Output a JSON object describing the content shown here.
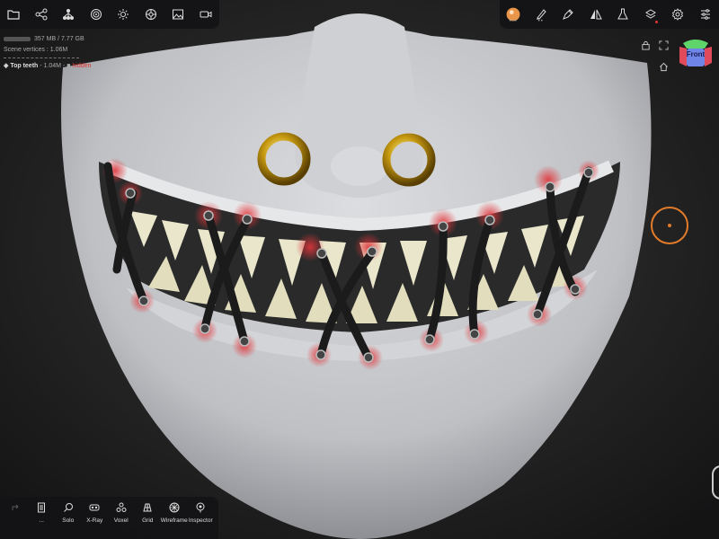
{
  "toolbar_left": {
    "icons": [
      "folder-icon",
      "share-icon",
      "scene-tree-icon",
      "materials-icon",
      "lighting-icon",
      "shading-icon",
      "image-icon",
      "camera-icon"
    ]
  },
  "toolbar_right": {
    "icons": [
      "matcap-icon",
      "brush-icon",
      "pen-tool-icon",
      "symmetry-icon",
      "flask-icon",
      "layers-icon",
      "settings-icon",
      "sliders-icon"
    ]
  },
  "info": {
    "memory": "357 MB / 7.77 GB",
    "vertices": "Scene vertices : 1.06M",
    "object_name": "Top teeth",
    "object_verts": " - 1.04M - ",
    "object_status": "hidden"
  },
  "nav_cube": {
    "label": "Front"
  },
  "bottom_bar": {
    "items": [
      {
        "label": "",
        "icon": "redo-icon"
      },
      {
        "label": "...",
        "icon": "document-icon"
      },
      {
        "label": "Solo",
        "icon": "search-icon"
      },
      {
        "label": "X-Ray",
        "icon": "xray-icon"
      },
      {
        "label": "Voxel",
        "icon": "voxel-icon"
      },
      {
        "label": "Grid",
        "icon": "grid-icon"
      },
      {
        "label": "Wireframe",
        "icon": "wireframe-icon"
      },
      {
        "label": "Inspector",
        "icon": "inspector-icon"
      }
    ]
  },
  "colors": {
    "accent": "#e27b2a",
    "alert": "#e0352f",
    "mask": "#c8c9cc",
    "stitch": "#1b1b1c",
    "ring": "#c79a10"
  }
}
